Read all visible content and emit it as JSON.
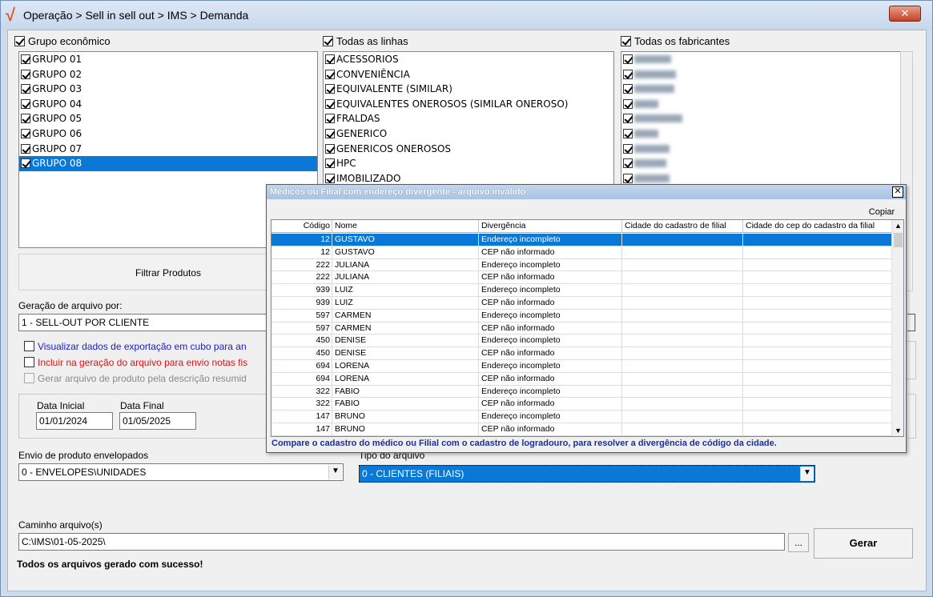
{
  "window": {
    "title": "Operação > Sell in sell out > IMS > Demanda",
    "close_label": "✕"
  },
  "groups": {
    "grupo_label": "Grupo econômico",
    "linhas_label": "Todas as linhas",
    "fabricantes_label": "Todas os fabricantes",
    "grupos": [
      "GRUPO 01",
      "GRUPO 02",
      "GRUPO 03",
      "GRUPO 04",
      "GRUPO 05",
      "GRUPO 06",
      "GRUPO 07",
      "GRUPO 08"
    ],
    "linhas": [
      "ACESSORIOS",
      "CONVENIÊNCIA",
      "EQUIVALENTE (SIMILAR)",
      "EQUIVALENTES ONEROSOS (SIMILAR ONEROSO)",
      "FRALDAS",
      "GENERICO",
      "GENERICOS ONEROSOS",
      "HPC",
      "IMOBILIZADO"
    ],
    "fabricantes_count": 9
  },
  "filter_button": "Filtrar Produtos",
  "geracao": {
    "label": "Geração de arquivo por:",
    "value": "1 - SELL-OUT POR CLIENTE"
  },
  "options": {
    "cubo": "Visualizar dados de exportação em cubo para an",
    "notas": "Incluir na geração do arquivo para envio notas fis",
    "descricao": "Gerar arquivo de produto pela descrição resumid"
  },
  "datas": {
    "inicial_label": "Data Inicial",
    "inicial": "01/01/2024",
    "final_label": "Data Final",
    "final": "01/05/2025"
  },
  "envio": {
    "label": "Envio de produto envelopados",
    "value": "0 - ENVELOPES\\UNIDADES"
  },
  "tipo": {
    "label": "Tipo do arquivo",
    "value": "0 - CLIENTES (FILIAIS)"
  },
  "caminho": {
    "label": "Caminho arquivo(s)",
    "value": "C:\\IMS\\01-05-2025\\",
    "browse": "..."
  },
  "gerar_button": "Gerar",
  "status": "Todos os arquivos gerado com sucesso!",
  "modal": {
    "title": "Médicos ou Filial com endereço divergente - arquivo inválido",
    "close": "✕",
    "copy": "Copiar",
    "columns": [
      "Código",
      "Nome",
      "Divergência",
      "Cidade do cadastro de filial",
      "Cidade do cep do cadastro da filial"
    ],
    "rows": [
      [
        "12",
        "GUSTAVO",
        "Endereço incompleto"
      ],
      [
        "12",
        "GUSTAVO",
        "CEP não informado"
      ],
      [
        "222",
        "JULIANA",
        "Endereço incompleto"
      ],
      [
        "222",
        "JULIANA",
        "CEP não informado"
      ],
      [
        "939",
        "LUIZ",
        "Endereço incompleto"
      ],
      [
        "939",
        "LUIZ",
        "CEP não informado"
      ],
      [
        "597",
        "CARMEN",
        "Endereço incompleto"
      ],
      [
        "597",
        "CARMEN",
        "CEP não informado"
      ],
      [
        "450",
        "DENISE",
        "Endereço incompleto"
      ],
      [
        "450",
        "DENISE",
        "CEP não informado"
      ],
      [
        "694",
        "LORENA",
        "Endereço incompleto"
      ],
      [
        "694",
        "LORENA",
        "CEP não informado"
      ],
      [
        "322",
        "FABIO",
        "Endereço incompleto"
      ],
      [
        "322",
        "FABIO",
        "CEP não informado"
      ],
      [
        "147",
        "BRUNO",
        "Endereço incompleto"
      ],
      [
        "147",
        "BRUNO",
        "CEP não informado"
      ]
    ],
    "footer": "Compare o cadastro do médico ou Filial com o cadastro de logradouro, para resolver a divergência de código da cidade."
  },
  "colors": {
    "selection": "#0a78d7",
    "blue_text": "#1a1acc",
    "red_text": "#e01010"
  }
}
